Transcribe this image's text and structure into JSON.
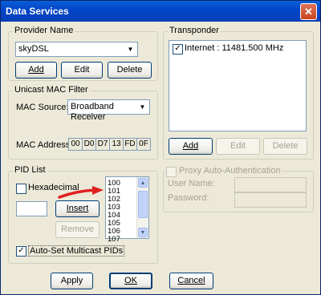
{
  "window": {
    "title": "Data Services",
    "close_glyph": "✕"
  },
  "provider": {
    "legend": "Provider Name",
    "selected": "skyDSL",
    "add_label": "Add",
    "edit_label": "Edit",
    "delete_label": "Delete"
  },
  "unicast": {
    "legend": "Unicast MAC Filter",
    "mac_source_label": "MAC Source:",
    "mac_source_value": "Broadband Receiver",
    "mac_address_label": "MAC Address:",
    "mac_bytes": [
      "00",
      "D0",
      "D7",
      "13",
      "FD",
      "0F"
    ]
  },
  "pid_list": {
    "legend": "PID List",
    "hexadecimal_label": "Hexadecimal",
    "pid_value": "",
    "insert_label": "Insert",
    "remove_label": "Remove",
    "pids": [
      "100",
      "101",
      "102",
      "103",
      "104",
      "105",
      "106",
      "107"
    ],
    "auto_set_label": "Auto-Set Multicast PIDs",
    "auto_set_checked": true
  },
  "transponder": {
    "legend": "Transponder",
    "items": [
      {
        "label": "Internet : 11481.500 MHz",
        "checked": true
      }
    ],
    "add_label": "Add",
    "edit_label": "Edit",
    "delete_label": "Delete"
  },
  "proxy": {
    "auth_label": "Proxy Auto-Authentication",
    "user_name_label": "User Name:",
    "password_label": "Password:"
  },
  "footer": {
    "apply_label": "Apply",
    "ok_label": "OK",
    "cancel_label": "Cancel"
  },
  "colors": {
    "title_bar": "#0a5fd6",
    "annotation_arrow": "#e02020",
    "dialog_bg": "#ece9d8"
  }
}
